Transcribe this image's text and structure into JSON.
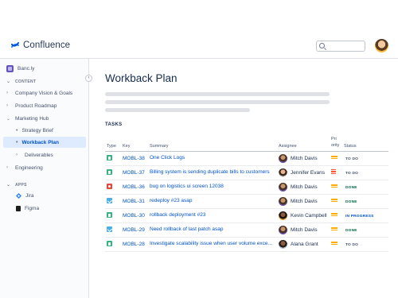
{
  "app": {
    "name": "Confluence"
  },
  "search": {
    "placeholder": ""
  },
  "sidebar": {
    "space_name": "Banc.ly",
    "collapse_glyph": "‹",
    "content_label": "CONTENT",
    "apps_label": "APPS",
    "items": [
      {
        "label": "Company Vision & Goals",
        "chevron": "›"
      },
      {
        "label": "Product Roadmap",
        "chevron": "›"
      },
      {
        "label": "Marketing Hub",
        "chevron": "⌄"
      },
      {
        "label": "Strategy Brief",
        "bullet": "•"
      },
      {
        "label": "Workback Plan",
        "bullet": "•"
      },
      {
        "label": "Deliverables",
        "chevron": "›"
      },
      {
        "label": "Engineering",
        "chevron": "›"
      }
    ],
    "apps": [
      {
        "label": "Jira",
        "icon": "jira-icon"
      },
      {
        "label": "Figma",
        "icon": "figma-icon"
      }
    ]
  },
  "main": {
    "title": "Workback Plan",
    "tasks_label": "TASKS",
    "columns": {
      "type": "Type",
      "key": "Key",
      "summary": "Summary",
      "assignee": "Assignee",
      "priority_1": "Pri",
      "priority_2": "ority",
      "status": "Status"
    },
    "rows": [
      {
        "type": "story",
        "key": "MOBL-38",
        "summary": "One Click Logs",
        "assignee": "Mitch Davis",
        "priority": "medium",
        "status": "TO DO"
      },
      {
        "type": "story",
        "key": "MOBL-37",
        "summary": "Billing system is sending duplicate bills to customers",
        "assignee": "Jennifer Evans",
        "priority": "high",
        "status": "TO DO"
      },
      {
        "type": "bug",
        "key": "MOBL-36",
        "summary": "bug on logistics ui screen 12038",
        "assignee": "Mitch Davis",
        "priority": "medium",
        "status": "DONE"
      },
      {
        "type": "task",
        "key": "MOBL-31",
        "summary": "redeploy #23 asap",
        "assignee": "Mitch Davis",
        "priority": "medium",
        "status": "DONE"
      },
      {
        "type": "story",
        "key": "MOBL-30",
        "summary": "rollback deployment #23",
        "assignee": "Kevin Campbell",
        "priority": "medium",
        "status": "IN PROGRESS"
      },
      {
        "type": "task",
        "key": "MOBL-29",
        "summary": "Need rollback of last patch asap",
        "assignee": "Mitch Davis",
        "priority": "medium",
        "status": "DONE"
      },
      {
        "type": "story",
        "key": "MOBL-28",
        "summary": "Investigate scalability issue when user volume exce...",
        "assignee": "Alana Grant",
        "priority": "medium",
        "status": "TO DO"
      }
    ]
  },
  "colors": {
    "brand": "#0052cc",
    "done": "#006644",
    "medium_priority": "#ffab00",
    "high_priority": "#ff5630"
  }
}
